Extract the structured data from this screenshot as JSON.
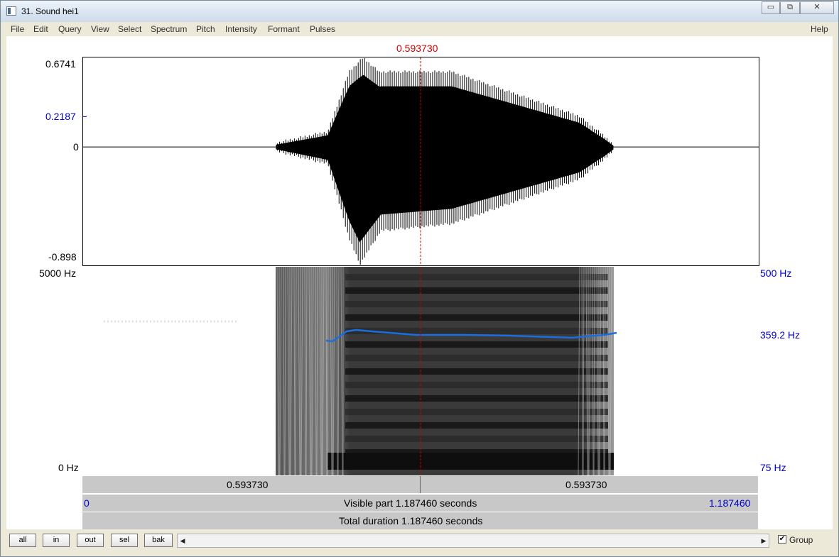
{
  "window": {
    "title": "31. Sound hei1",
    "minimize_glyph": "▭",
    "restore_glyph": "⧉",
    "close_glyph": "✕"
  },
  "menu": [
    "File",
    "Edit",
    "Query",
    "View",
    "Select",
    "Spectrum",
    "Pitch",
    "Intensity",
    "Formant",
    "Pulses"
  ],
  "help": "Help",
  "cursor_time": "0.593730",
  "waveform": {
    "top": "0.6741",
    "mid": "0.2187",
    "zero": "0",
    "bottom": "-0.898"
  },
  "spectrogram": {
    "freq_top": "5000 Hz",
    "freq_bottom": "0 Hz"
  },
  "pitch": {
    "top": "500 Hz",
    "current": "359.2 Hz",
    "bottom": "75 Hz"
  },
  "time_bar": {
    "left": "0.593730",
    "right": "0.593730"
  },
  "visible_bar": {
    "start": "0",
    "label": "Visible part 1.187460 seconds",
    "end": "1.187460"
  },
  "total_bar": {
    "label": "Total duration 1.187460 seconds"
  },
  "buttons": {
    "all": "all",
    "in": "in",
    "out": "out",
    "sel": "sel",
    "bak": "bak"
  },
  "group": {
    "label": "Group",
    "checked": true,
    "check_glyph": "✔"
  },
  "scroll": {
    "left_glyph": "◀",
    "right_glyph": "▶"
  },
  "colors": {
    "cursor": "#d00000",
    "pitch_curve": "#1a6fe0",
    "axis_blue": "#0000cc"
  }
}
